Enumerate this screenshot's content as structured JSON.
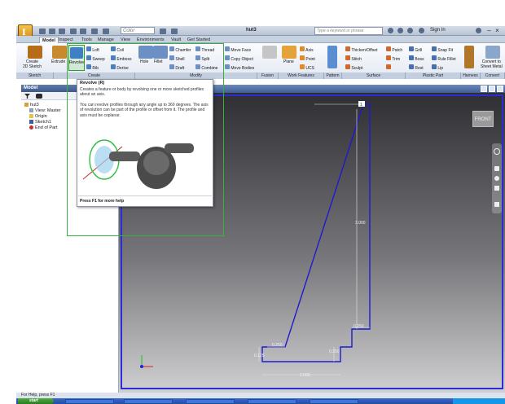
{
  "quick_access": {
    "color_value": "Color",
    "doc_title": "hut3",
    "search_placeholder": "Type a keyword or phrase",
    "sign_in": "Sign In",
    "app_letter": "I"
  },
  "tabs": [
    "Model",
    "Inspect",
    "Tools",
    "Manage",
    "View",
    "Environments",
    "Vault",
    "Get Started"
  ],
  "ribbon": {
    "create_sketch": "Create\n2D Sketch",
    "extrude": "Extrude",
    "revolve": "Revolve",
    "loft": "Loft",
    "sweep": "Sweep",
    "rib": "Rib",
    "coil": "Coil",
    "emboss": "Emboss",
    "derive": "Derive",
    "hole": "Hole",
    "fillet": "Fillet",
    "chamfer": "Chamfer",
    "shell": "Shell",
    "draft": "Draft",
    "thread": "Thread",
    "split": "Split",
    "combine": "Combine",
    "move_face": "Move Face",
    "copy_object": "Copy Object",
    "move_bodies": "Move Bodies",
    "plane": "Plane",
    "axis": "Axis",
    "point": "Point",
    "ucs": "UCS",
    "thicken": "Thicken/Offset",
    "stitch": "Stitch",
    "sculpt": "Sculpt",
    "patch": "Patch",
    "trim": "Trim",
    "grill": "Grill",
    "boss": "Boss",
    "rest": "Rest",
    "snap_fit": "Snap Fit",
    "rule_fillet": "Rule Fillet",
    "lip": "Lip",
    "convert": "Convert to\nSheet Metal",
    "panels": [
      "Sketch",
      "Create",
      "Modify",
      "Fusion",
      "Work Features",
      "Pattern",
      "Surface",
      "Plastic Part",
      "Harness",
      "Convert"
    ]
  },
  "browser": {
    "title": "Model",
    "items": [
      "hut3",
      "View: Master",
      "Origin",
      "Sketch1",
      "End of Part"
    ]
  },
  "tooltip": {
    "title": "Revolve (R)",
    "line1": "Creates a feature or body by revolving one or more sketched profiles about an axis.",
    "line2": "You can revolve profiles through any angle up to 360 degrees. The axis of revolution can be part of the profile or offset from it. The profile and axis must be coplanar.",
    "help": "Press F1 for more help"
  },
  "viewcube": {
    "label": "FRONT"
  },
  "dimensions": {
    "height": "3.000",
    "step_width": "0.250",
    "base_height": "0.250",
    "left_width": "0.250",
    "total_width": "1.000",
    "left_height": "0.125",
    "top": "1"
  },
  "status": "For Help, press F1",
  "taskbar": {
    "start": "start"
  }
}
